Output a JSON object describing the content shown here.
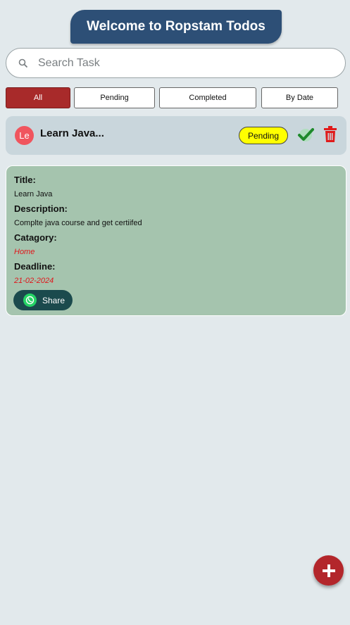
{
  "header": {
    "title": "Welcome to Ropstam Todos"
  },
  "search": {
    "placeholder": "Search Task",
    "value": ""
  },
  "filters": [
    {
      "label": "All",
      "active": true
    },
    {
      "label": "Pending",
      "active": false
    },
    {
      "label": "Completed",
      "active": false
    },
    {
      "label": "By Date",
      "active": false
    }
  ],
  "task": {
    "avatar_initials": "Le",
    "title": "Learn Java...",
    "status": "Pending"
  },
  "detail": {
    "title_label": "Title:",
    "title_value": "Learn Java",
    "description_label": "Description:",
    "description_value": "Complte java course and get certiifed",
    "category_label": "Catagory:",
    "category_value": "Home",
    "deadline_label": "Deadline:",
    "deadline_value": "21-02-2024",
    "share_label": "Share"
  },
  "fab": {
    "icon": "plus-icon"
  },
  "colors": {
    "background": "#e2e9ec",
    "header": "#2d4f76",
    "active_filter": "#a82a2a",
    "pending_badge": "#ffff00",
    "detail_card": "#a5c4ae",
    "fab": "#b3262b"
  }
}
